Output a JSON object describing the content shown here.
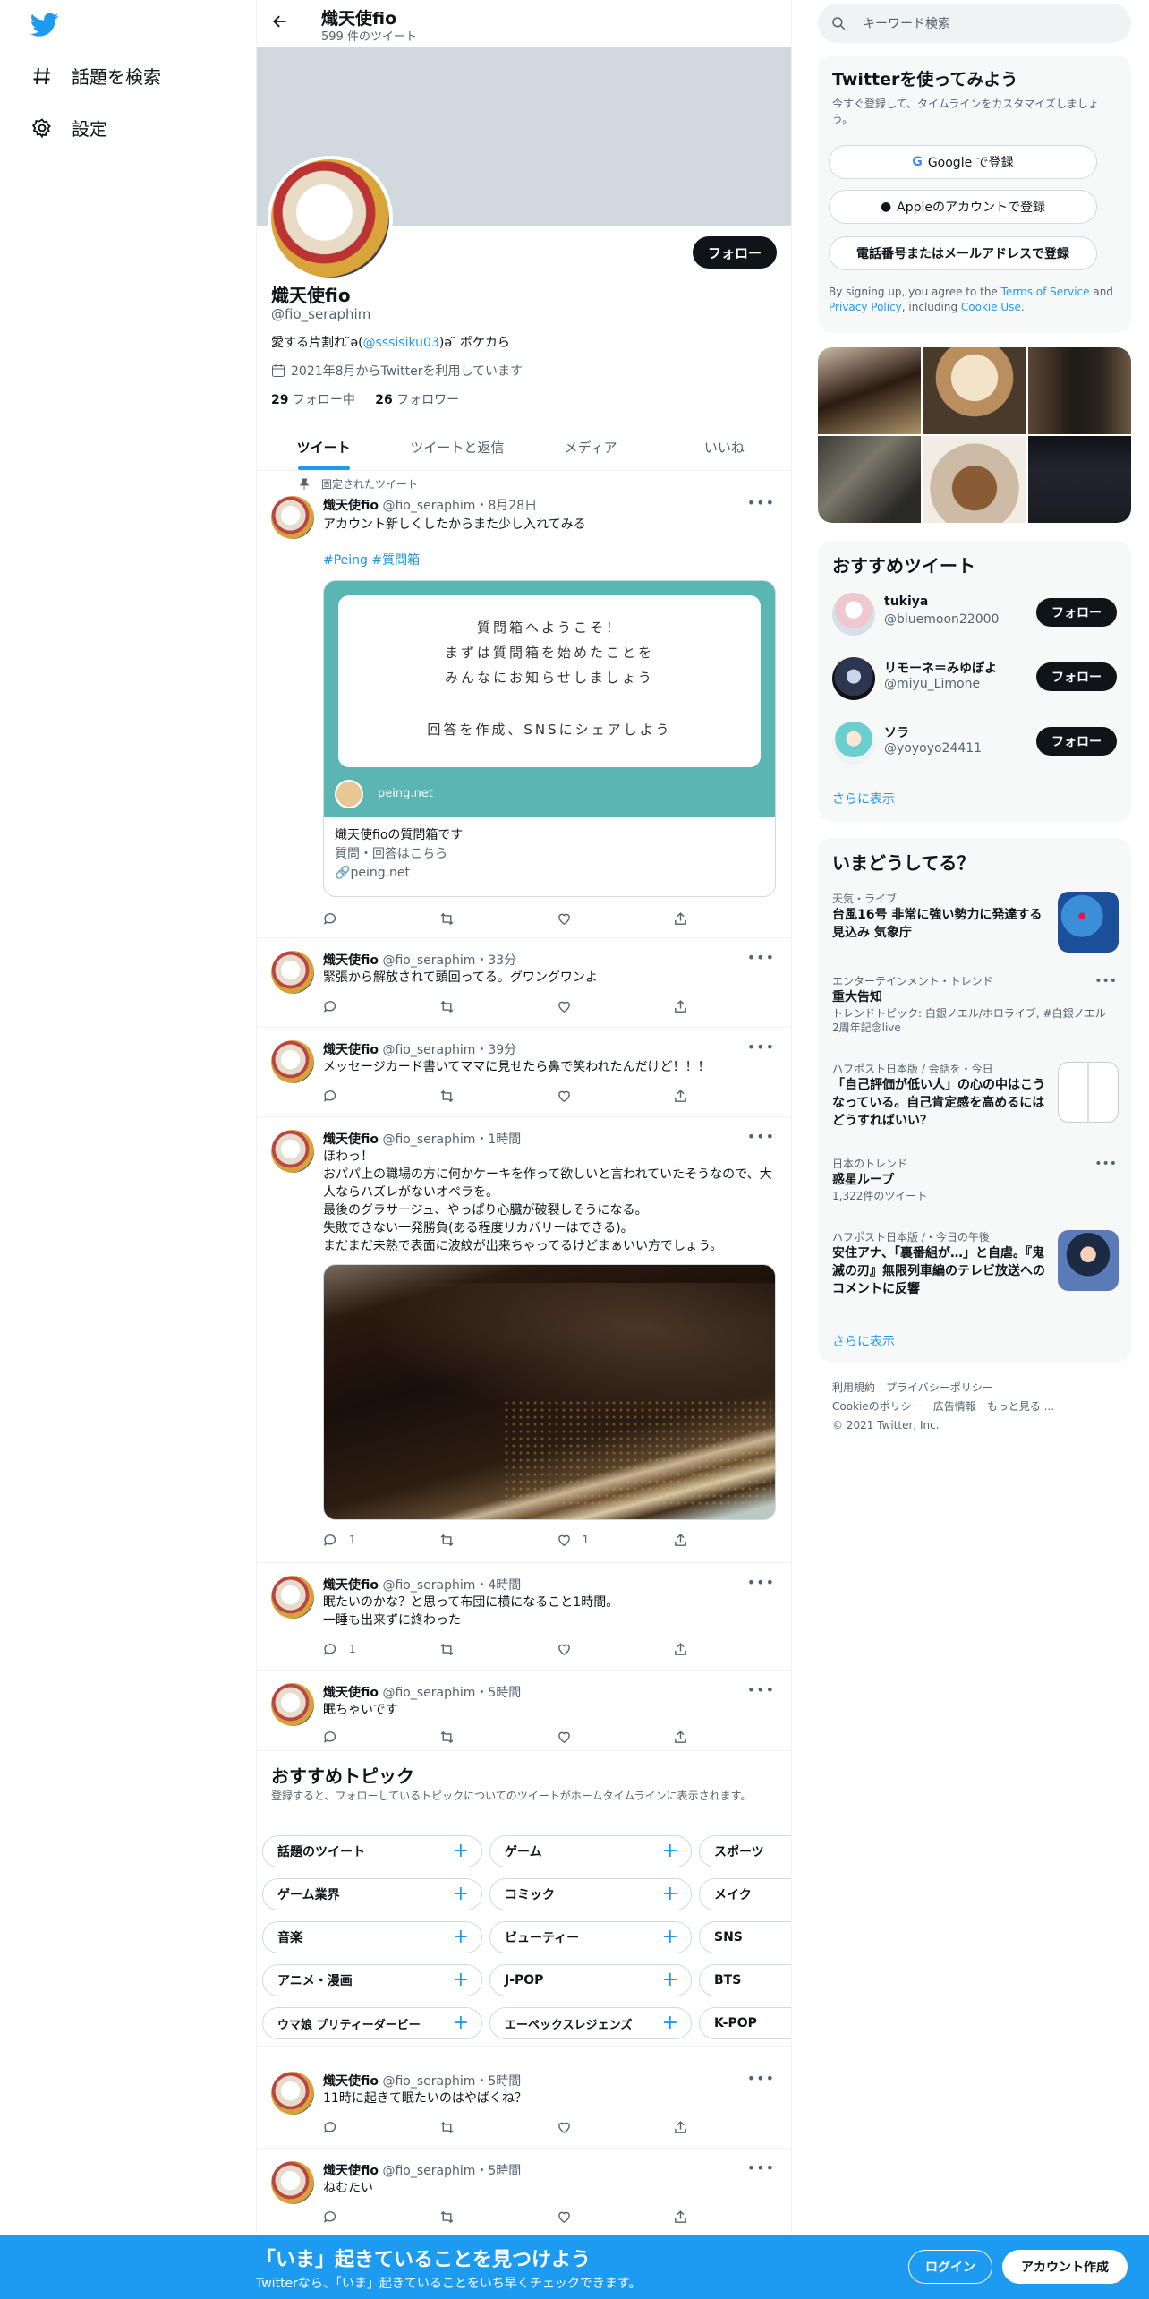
{
  "nav": {
    "explore_label": "話題を検索",
    "settings_label": "設定"
  },
  "header": {
    "name": "熾天使fio",
    "tweet_count": "599 件のツイート"
  },
  "profile": {
    "follow_label": "フォロー",
    "name": "熾天使fio",
    "handle": "@fio_seraphim",
    "bio_prefix": "愛する片割れ ̈ə(",
    "bio_mention": "@sssisiku03",
    "bio_suffix": ")ə ̈  ポケカら",
    "joined": "2021年8月からTwitterを利用しています",
    "following_count": "29",
    "following_label": " フォロー中",
    "followers_count": "26",
    "followers_label": " フォロワー"
  },
  "tabs": [
    "ツイート",
    "ツイートと返信",
    "メディア",
    "いいね"
  ],
  "pinned_label": "固定されたツイート",
  "tweet_name": "熾天使fio",
  "tweet_handle": "@fio_seraphim",
  "tweets": [
    {
      "time": "・8月28日",
      "text": "アカウント新しくしたからまた少し入れてみる",
      "hashtags": "#Peing #質問箱",
      "card": {
        "lines": [
          "質問箱へようこそ！",
          "まずは質問箱を始めたことを",
          "みんなにお知らせしましょう",
          "回答を作成、SNSにシェアしよう"
        ],
        "image_domain": "peing.net",
        "title": "熾天使fioの質問箱です",
        "desc": "質問・回答はこちら",
        "domain": "peing.net"
      }
    },
    {
      "time": "・33分",
      "text": "緊張から解放されて頭回ってる。グワングワンよ"
    },
    {
      "time": "・39分",
      "text": "メッセージカード書いてママに見せたら鼻で笑われたんだけど！！！"
    },
    {
      "time": "・1時間",
      "lines": [
        "ほわっ！",
        "おパパ上の職場の方に何かケーキを作って欲しいと言われていたそうなので、大人ならハズレがないオペラを。",
        "最後のグラサージュ、やっぱり心臓が破裂しそうになる。",
        "失敗できない一発勝負(ある程度リカバリーはできる)。",
        "まだまだ未熟で表面に波紋が出来ちゃってるけどまぁいい方でしょう。"
      ],
      "reply_count": "1",
      "like_count": "1"
    },
    {
      "time": "・4時間",
      "lines": [
        "眠たいのかな？と思って布団に横になること1時間。",
        "一睡も出来ずに終わった"
      ],
      "reply_count": "1"
    },
    {
      "time": "・5時間",
      "text": "眠ちゃいです"
    },
    {
      "time": "・5時間",
      "text": "11時に起きて眠たいのはやばくね？"
    },
    {
      "time": "・5時間",
      "text": "ねむたい"
    }
  ],
  "topics": {
    "title": "おすすめトピック",
    "subtitle": "登録すると、フォローしているトピックについてのツイートがホームタイムラインに表示されます。",
    "rows": [
      [
        "話題のツイート",
        "ゲーム",
        "スポーツ"
      ],
      [
        "ゲーム業界",
        "コミック",
        "メイク"
      ],
      [
        "音楽",
        "ビューティー",
        "SNS"
      ],
      [
        "アニメ・漫画",
        "J-POP",
        "BTS"
      ],
      [
        "ウマ娘 プリティーダービー",
        "エーペックスレジェンズ",
        "K-POP"
      ]
    ]
  },
  "search": {
    "placeholder": "キーワード検索"
  },
  "signup": {
    "title": "Twitterを使ってみよう",
    "subtitle": "今すぐ登録して、タイムラインをカスタマイズしましょう。",
    "google": "Google で登録",
    "apple": "Appleのアカウントで登録",
    "phone": "電話番号またはメールアドレスで登録",
    "legal_1": "By signing up, you agree to the ",
    "terms": "Terms of Service",
    "legal_2": " and ",
    "privacy": "Privacy Policy",
    "legal_3": ", including ",
    "cookie": "Cookie Use",
    "legal_4": "."
  },
  "who_to_follow": {
    "title": "おすすめツイート",
    "users": [
      {
        "name": "tukiya",
        "handle": "@bluemoon22000",
        "button": "フォロー"
      },
      {
        "name": "リモーネ＝みゆぽよ",
        "handle": "@miyu_Limone",
        "button": "フォロー"
      },
      {
        "name": "ソラ",
        "handle": "@yoyoyo24411",
        "button": "フォロー"
      }
    ],
    "show_more": "さらに表示"
  },
  "trends": {
    "title": "いまどうしてる？",
    "items": [
      {
        "context": "天気・ライブ",
        "title": "台風16号 非常に強い勢力に発達する見込み 気象庁"
      },
      {
        "context": "エンターテインメント・トレンド",
        "title": "重大告知",
        "extra": "トレンドトピック: 白銀ノエル/ホロライブ, #白銀ノエル2周年記念live"
      },
      {
        "context": "ハフポスト日本版 / 会話を・今日",
        "title": "「自己評価が低い人」の心の中はこうなっている。自己肯定感を高めるにはどうすればいい？"
      },
      {
        "context": "日本のトレンド",
        "title": "惑星ループ",
        "extra": "1,322件のツイート"
      },
      {
        "context": "ハフポスト日本版 /・今日の午後",
        "title": "安住アナ、「裏番組が…」と自虐。『鬼滅の刃』無限列車編のテレビ放送へのコメントに反響"
      }
    ],
    "show_more": "さらに表示"
  },
  "footer": {
    "links": [
      "利用規約",
      "プライバシーポリシー",
      "Cookieのポリシー",
      "広告情報",
      "もっと見る ..."
    ],
    "copyright": "© 2021 Twitter, Inc."
  },
  "bottom_bar": {
    "title": "「いま」起きていることを見つけよう",
    "subtitle": "Twitterなら、「いま」起きていることをいち早くチェックできます。",
    "login": "ログイン",
    "signup": "アカウント作成"
  },
  "colors": {
    "accent": "#1d9bf0",
    "text": "#0f1419",
    "muted": "#536471"
  }
}
